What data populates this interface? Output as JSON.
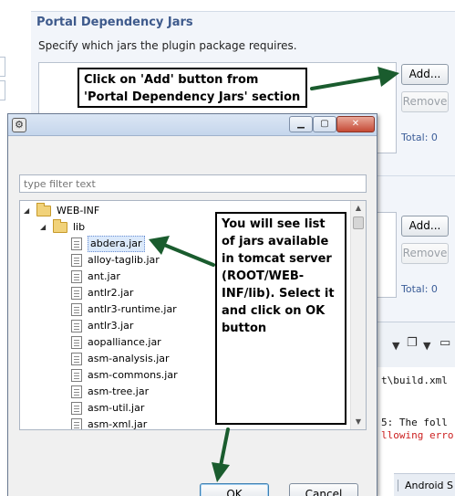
{
  "editor": {
    "section_title": "Portal Dependency Jars",
    "section_description": "Specify which jars the plugin package requires.",
    "add_label": "Add...",
    "remove_label": "Remove",
    "total_label": "Total: 0",
    "add2_label": "Add...",
    "remove2_label": "Remove",
    "total2_label": "Total: 0",
    "console_lines": [
      "t\\build.xml",
      "5: The foll",
      "llowing erro"
    ],
    "status_tab": "Android S"
  },
  "dialog": {
    "filter_placeholder": "type filter text",
    "tree": {
      "root": "WEB-INF",
      "folder": "lib",
      "jars": [
        "abdera.jar",
        "alloy-taglib.jar",
        "ant.jar",
        "antlr2.jar",
        "antlr3-runtime.jar",
        "antlr3.jar",
        "aopalliance.jar",
        "asm-analysis.jar",
        "asm-commons.jar",
        "asm-tree.jar",
        "asm-util.jar",
        "asm-xml.jar"
      ],
      "selected": "abdera.jar"
    },
    "ok_label": "OK",
    "cancel_label": "Cancel"
  },
  "annotations": {
    "add_callout": "Click on 'Add' button from 'Portal Dependency Jars' section",
    "jars_callout": "You will see list of jars available in tomcat server (ROOT/WEB-INF/lib). Select it and click on OK button"
  },
  "colors": {
    "arrow": "#1a5c2e",
    "section_title": "#3e5a8c",
    "selection": "#dbe9fb"
  }
}
